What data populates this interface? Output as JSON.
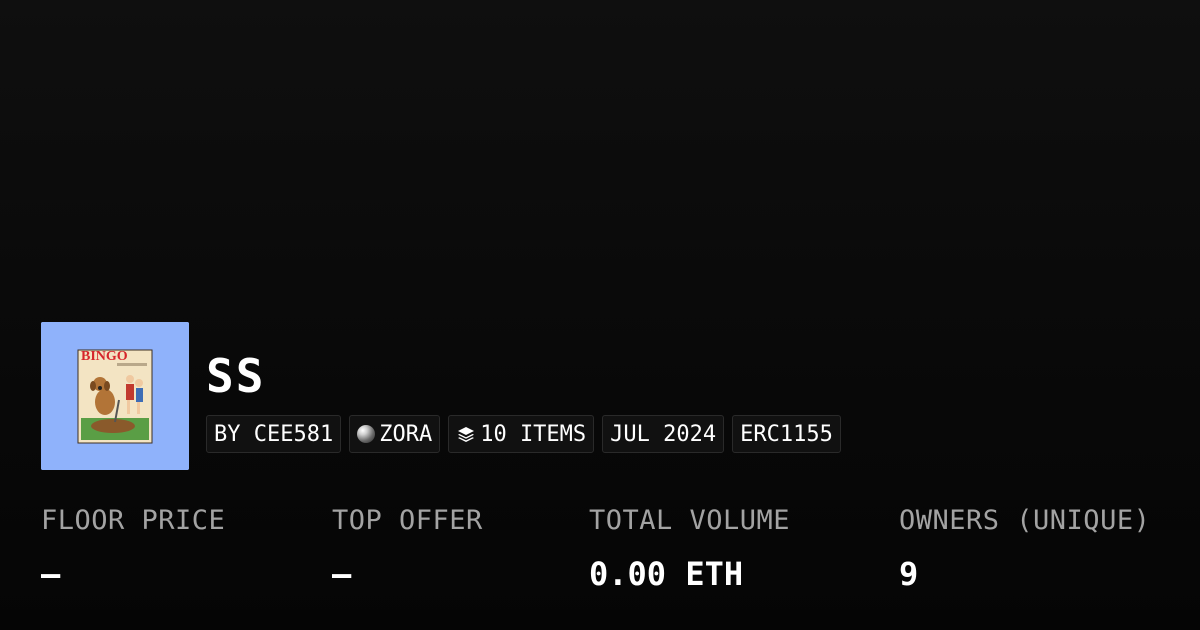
{
  "collection": {
    "name": "SS",
    "image_text": "BINGO",
    "image_bg_color": "#8fb2fb"
  },
  "tags": {
    "creator": "BY CEE581",
    "chain": "ZORA",
    "chain_icon": "zora-orb-icon",
    "items": "10 ITEMS",
    "items_icon": "layers-icon",
    "date": "JUL 2024",
    "standard": "ERC1155"
  },
  "stats": [
    {
      "label": "FLOOR PRICE",
      "value": "–"
    },
    {
      "label": "TOP OFFER",
      "value": "–"
    },
    {
      "label": "TOTAL VOLUME",
      "value": "0.00 ETH"
    },
    {
      "label": "OWNERS (UNIQUE)",
      "value": "9"
    }
  ]
}
